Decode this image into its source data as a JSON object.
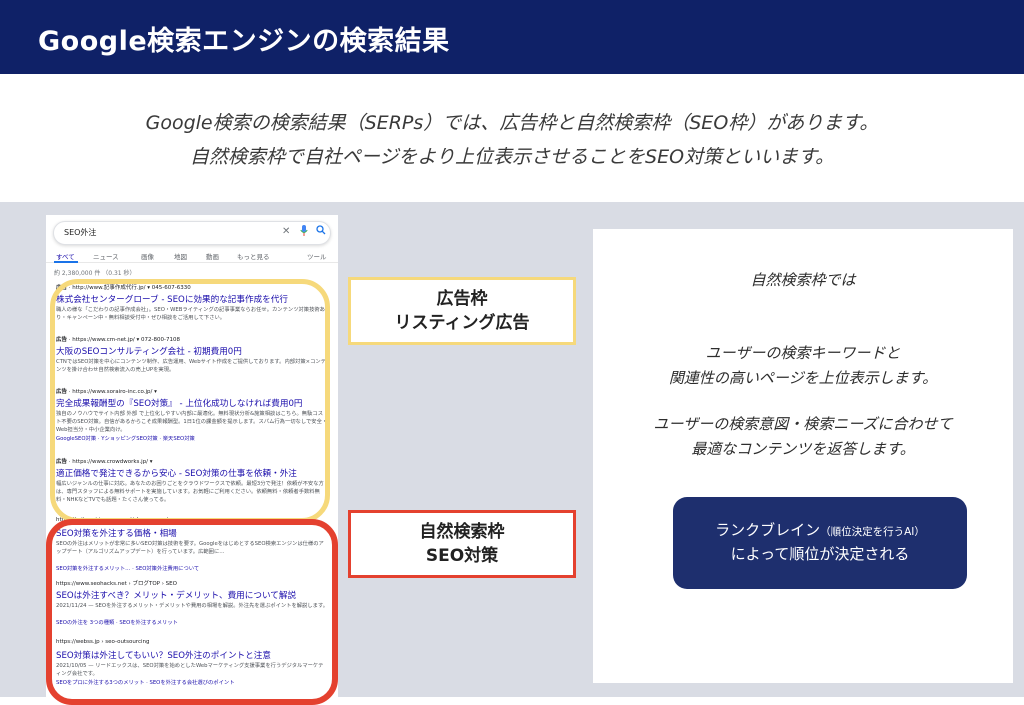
{
  "header": {
    "title": "Google検索エンジンの検索結果"
  },
  "intro": {
    "line1": "Google検索の検索結果（SERPs）では、広告枠と自然検索枠（SEO枠）があります。",
    "line2": "自然検索枠で自社ページをより上位表示させることをSEO対策といいます。"
  },
  "serp": {
    "query": "SEO外注",
    "tabs": [
      "すべて",
      "ニュース",
      "画像",
      "地図",
      "動画",
      "もっと見る",
      "ツール"
    ],
    "result_count": "約 2,380,000 件 （0.31 秒）",
    "results": [
      {
        "url_prefix": "広告",
        "url": "http://www.記事作成代行.jp/",
        "phone": "045-607-6330",
        "title": "株式会社センターグローブ - SEOに効果的な記事作成を代行",
        "desc": "職人の様な「こだわりの記事作成会社」。SEO・WEBライティングの記事事業ならお任せ。カンテンツ対策技術あり・キャンペーン中・無料相談受付中・ぜひ相談をご活用して下さい。",
        "links": ""
      },
      {
        "url_prefix": "広告",
        "url": "https://www.cm-net.jp/",
        "phone": "072-800-7108",
        "title": "大阪のSEOコンサルティング会社 - 初期費用0円",
        "desc": "CTNではSEO対策を中心にコンテンツ制作、広告運用、Webサイト作成をご提供しております。内部対策×コンテンツを掛け合わせ自然検索流入の売上UPを実現。",
        "links": ""
      },
      {
        "url_prefix": "広告",
        "url": "https://www.sorairo-inc.co.jp/",
        "phone": "",
        "title": "完全成果報酬型の『SEO対策』 - 上位化成功しなければ費用0円",
        "desc": "独自のノウハウでサイト内部 外部 で上位化しやすい内部に最適化。無料現状分析&施策相談はこちら。無駄コスト不要のSEO対策。自信があるからこそ成果報酬型。1日1位の課金額を提示します。スパム行為一切なしで安全・Web担当分・中小企業向け。",
        "links": "GoogleSEO対策 · YショッピングSEO対策 · 楽天SEO対策"
      },
      {
        "url_prefix": "広告",
        "url": "https://www.crowdworks.jp/",
        "phone": "",
        "title": "適正価格で発注できるから安心 - SEO対策の仕事を依頼・外注",
        "desc": "幅広いジャンルの仕事に対応。あなたのお困りごとをクラウドワークスで依頼。最短3分で発注！依頼が不安な方は、専門スタッフによる無料サポートを実施しています。お気軽にご利用ください。依頼無料・依頼者手数料無料・NHKなどTVでも話題・たくさん使ってる。",
        "links": ""
      },
      {
        "url_prefix": "",
        "url": "https://mitsu-ri.jp › seo › articles › seoaut",
        "phone": "",
        "title": "SEO対策を外注する価格・相場",
        "desc": "SEOの外注はメリットが非常に多いSEO対策は技術を要す。GoogleをはじめとするSEO検索エンジンは仕様のアップデート（アルゴリズムアップデート）を行っています。広範囲に…",
        "links": "SEO対策を外注するメリット… · SEO対策外注費用について"
      },
      {
        "url_prefix": "",
        "url": "https://www.seohacks.net › ブログTOP › SEO",
        "phone": "",
        "title": "SEOは外注すべき？メリット・デメリット、費用について解説",
        "desc": "2021/11/24 — SEOを外注するメリット・デメリットや費用の相場を解説。外注先を選ぶポイントを解説します。",
        "links": "SEOの外注を 3つの種類 · SEOを外注するメリット"
      },
      {
        "url_prefix": "",
        "url": "https://webss.jp › seo-outsourcing",
        "phone": "",
        "title": "SEO対策は外注してもいい？SEO外注のポイントと注意",
        "desc": "2021/10/05 — リードエックスは、SEO対策を始めとしたWebマーケティング支援事業を行うデジタルマーケティング会社です。",
        "links": "SEOをプロに外注する3つのメリット · SEOを外注する会社選びのポイント"
      }
    ]
  },
  "labels": {
    "ad_line1": "広告枠",
    "ad_line2": "リスティング広告",
    "seo_line1": "自然検索枠",
    "seo_line2": "SEO対策"
  },
  "card": {
    "heading": "自然検索枠では",
    "p1_line1": "ユーザーの検索キーワードと",
    "p1_line2": "関連性の高いページを上位表示します。",
    "p2_line1": "ユーザーの検索意図・検索ニーズに合わせて",
    "p2_line2": "最適なコンテンツを返答します。",
    "rank_line1_main": "ランクブレイン",
    "rank_line1_small": "（順位決定を行うAI）",
    "rank_line2": "によって順位が決定される"
  },
  "colors": {
    "header_bg": "#0f2167",
    "panel_bg": "#d9dce4",
    "ad_frame": "#f6d97b",
    "seo_frame": "#e4412f",
    "rank_bg": "#1e2f6e",
    "link_blue": "#1a0dab"
  },
  "icons": [
    "clear-icon",
    "mic-icon",
    "search-icon"
  ]
}
